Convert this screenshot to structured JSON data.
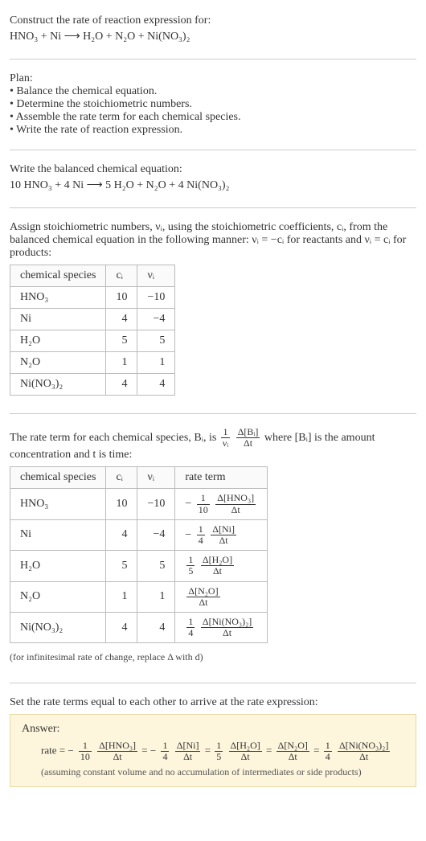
{
  "title": {
    "line1": "Construct the rate of reaction expression for:",
    "eq": "HNO₃ + Ni ⟶ H₂O + N₂O + Ni(NO₃)₂"
  },
  "plan": {
    "heading": "Plan:",
    "b1": "• Balance the chemical equation.",
    "b2": "• Determine the stoichiometric numbers.",
    "b3": "• Assemble the rate term for each chemical species.",
    "b4": "• Write the rate of reaction expression."
  },
  "balanced": {
    "heading": "Write the balanced chemical equation:",
    "eq": "10 HNO₃ + 4 Ni ⟶ 5 H₂O + N₂O + 4 Ni(NO₃)₂"
  },
  "assign": {
    "p1": "Assign stoichiometric numbers, νᵢ, using the stoichiometric coefficients, cᵢ, from the balanced chemical equation in the following manner: νᵢ = −cᵢ for reactants and νᵢ = cᵢ for products:"
  },
  "tbl1": {
    "h1": "chemical species",
    "h2": "cᵢ",
    "h3": "νᵢ",
    "r1a": "HNO₃",
    "r1b": "10",
    "r1c": "−10",
    "r2a": "Ni",
    "r2b": "4",
    "r2c": "−4",
    "r3a": "H₂O",
    "r3b": "5",
    "r3c": "5",
    "r4a": "N₂O",
    "r4b": "1",
    "r4c": "1",
    "r5a": "Ni(NO₃)₂",
    "r5b": "4",
    "r5c": "4"
  },
  "rateterm": {
    "pA": "The rate term for each chemical species, Bᵢ, is ",
    "fracN": "1",
    "fracD": "νᵢ",
    "frac2N": "Δ[Bᵢ]",
    "frac2D": "Δt",
    "pB": " where [Bᵢ] is the amount concentration and t is time:"
  },
  "tbl2": {
    "h1": "chemical species",
    "h2": "cᵢ",
    "h3": "νᵢ",
    "h4": "rate term",
    "r1a": "HNO₃",
    "r1b": "10",
    "r1c": "−10",
    "r1rN1": "1",
    "r1rD1": "10",
    "r1rN2": "Δ[HNO₃]",
    "r1rD2": "Δt",
    "r1neg": "−",
    "r2a": "Ni",
    "r2b": "4",
    "r2c": "−4",
    "r2rN1": "1",
    "r2rD1": "4",
    "r2rN2": "Δ[Ni]",
    "r2rD2": "Δt",
    "r2neg": "−",
    "r3a": "H₂O",
    "r3b": "5",
    "r3c": "5",
    "r3rN1": "1",
    "r3rD1": "5",
    "r3rN2": "Δ[H₂O]",
    "r3rD2": "Δt",
    "r3neg": "",
    "r4a": "N₂O",
    "r4b": "1",
    "r4c": "1",
    "r4rN1": "",
    "r4rD1": "",
    "r4rN2": "Δ[N₂O]",
    "r4rD2": "Δt",
    "r4neg": "",
    "r5a": "Ni(NO₃)₂",
    "r5b": "4",
    "r5c": "4",
    "r5rN1": "1",
    "r5rD1": "4",
    "r5rN2": "Δ[Ni(NO₃)₂]",
    "r5rD2": "Δt",
    "r5neg": ""
  },
  "infnote": "(for infinitesimal rate of change, replace Δ with d)",
  "setequal": "Set the rate terms equal to each other to arrive at the rate expression:",
  "answer": {
    "label": "Answer:",
    "pre": "rate = ",
    "t1neg": "−",
    "t1N1": "1",
    "t1D1": "10",
    "t1N2": "Δ[HNO₃]",
    "t1D2": "Δt",
    "eq1": " = ",
    "t2neg": "−",
    "t2N1": "1",
    "t2D1": "4",
    "t2N2": "Δ[Ni]",
    "t2D2": "Δt",
    "eq2": " = ",
    "t3N1": "1",
    "t3D1": "5",
    "t3N2": "Δ[H₂O]",
    "t3D2": "Δt",
    "eq3": " = ",
    "t4N2": "Δ[N₂O]",
    "t4D2": "Δt",
    "eq4": " = ",
    "t5N1": "1",
    "t5D1": "4",
    "t5N2": "Δ[Ni(NO₃)₂]",
    "t5D2": "Δt",
    "note": "(assuming constant volume and no accumulation of intermediates or side products)"
  }
}
